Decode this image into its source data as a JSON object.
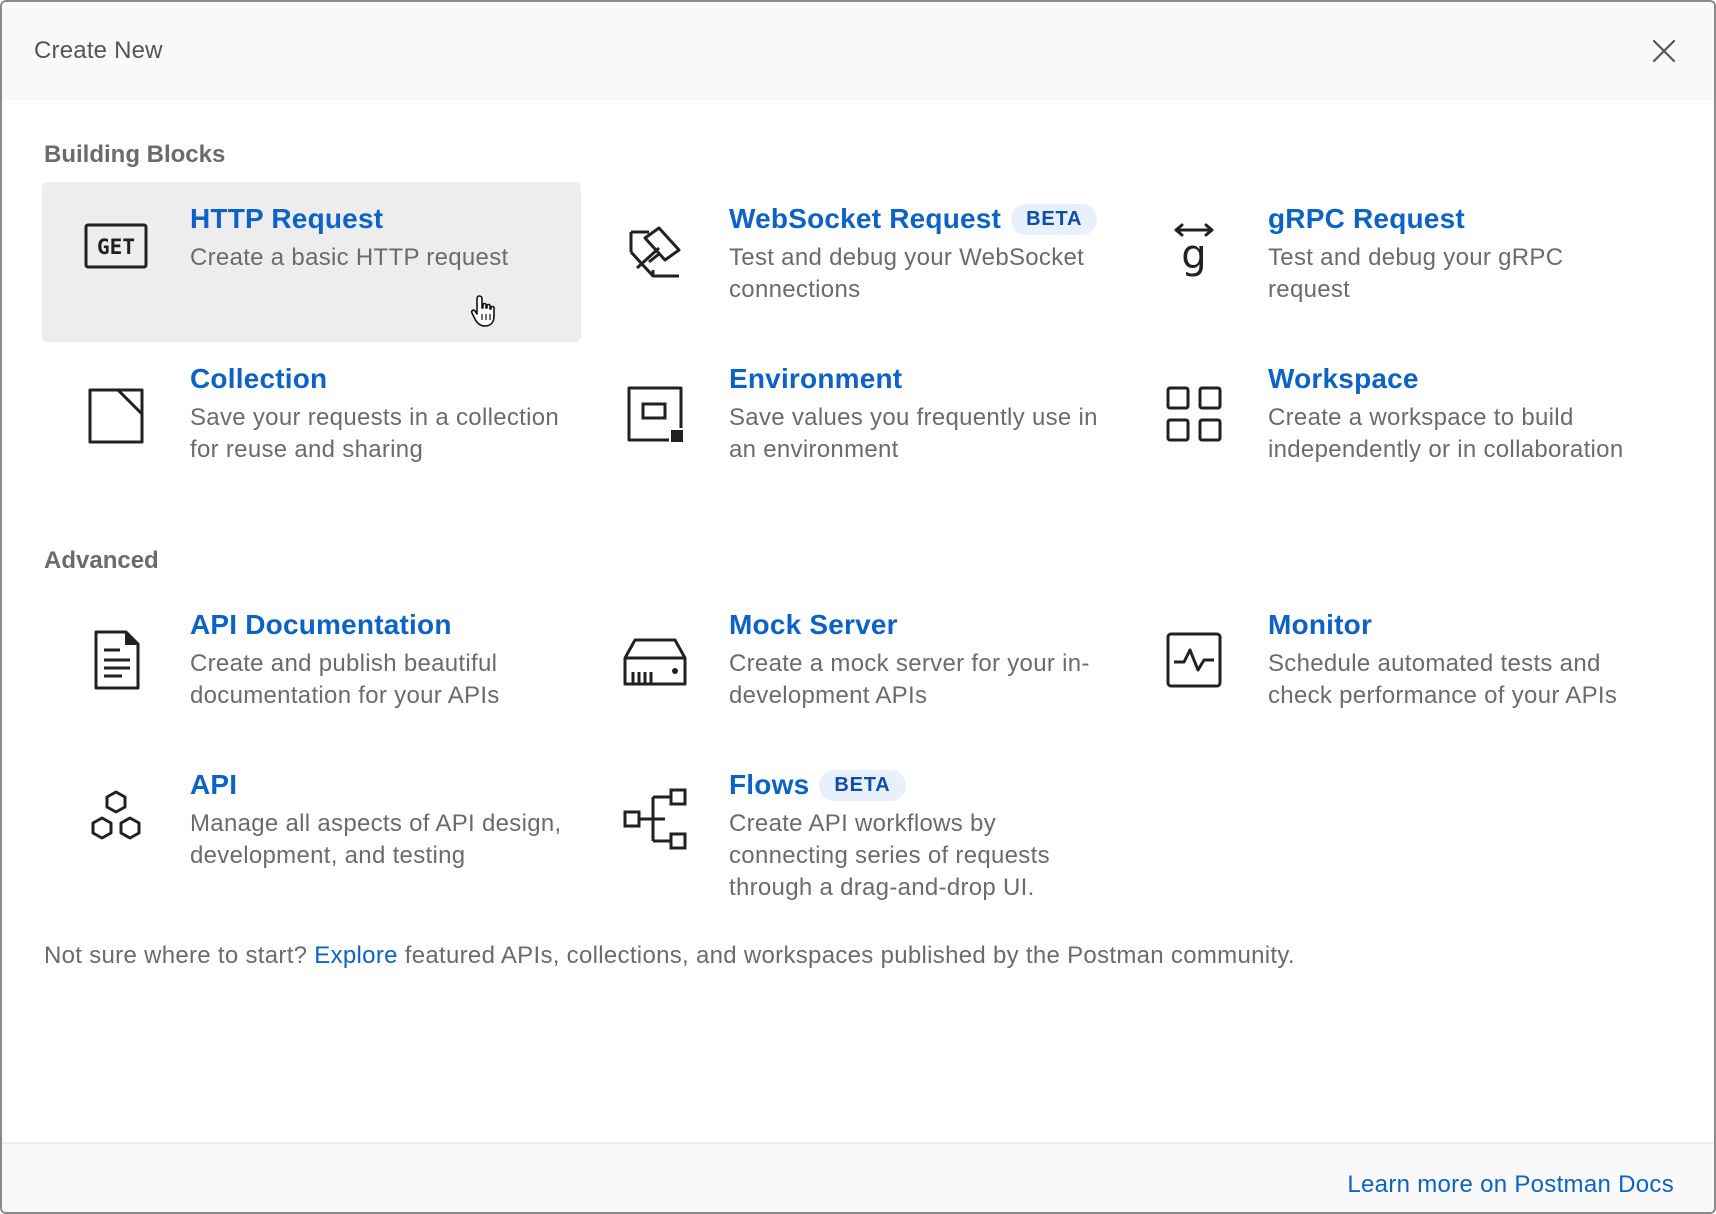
{
  "header": {
    "title": "Create New",
    "close_icon": "close-icon"
  },
  "building_blocks": {
    "title": "Building Blocks",
    "items": [
      {
        "title": "HTTP Request",
        "desc": "Create a basic HTTP request",
        "icon": "get-icon",
        "icon_text": "GET"
      },
      {
        "title": "WebSocket Request",
        "badge": "BETA",
        "desc": "Test and debug your WebSocket connections",
        "icon": "websocket-icon"
      },
      {
        "title": "gRPC Request",
        "desc": "Test and debug your gRPC request",
        "icon": "grpc-icon",
        "icon_text": "g"
      },
      {
        "title": "Collection",
        "desc": "Save your requests in a collection for reuse and sharing",
        "icon": "collection-icon"
      },
      {
        "title": "Environment",
        "desc": "Save values you frequently use in an environment",
        "icon": "environment-icon"
      },
      {
        "title": "Workspace",
        "desc": "Create a workspace to build independently or in collaboration",
        "icon": "workspace-icon"
      }
    ]
  },
  "advanced": {
    "title": "Advanced",
    "items": [
      {
        "title": "API Documentation",
        "desc": "Create and publish beautiful documentation for your APIs",
        "icon": "document-icon"
      },
      {
        "title": "Mock Server",
        "desc": "Create a mock server for your in-development APIs",
        "icon": "server-icon"
      },
      {
        "title": "Monitor",
        "desc": "Schedule automated tests and check performance of your APIs",
        "icon": "monitor-icon"
      },
      {
        "title": "API",
        "desc": "Manage all aspects of API design, development, and testing",
        "icon": "api-icon"
      },
      {
        "title": "Flows",
        "badge": "BETA",
        "desc": "Create API workflows by connecting series of requests through a drag-and-drop UI.",
        "icon": "flows-icon"
      }
    ]
  },
  "footer_note": {
    "prefix": "Not sure where to start?",
    "link": "Explore",
    "suffix": "featured APIs, collections, and workspaces published by the Postman community."
  },
  "bottom_bar": {
    "docs_link": "Learn more on Postman Docs"
  },
  "colors": {
    "link": "#0b63c9",
    "badge_bg": "#e8f0fb",
    "hover_bg": "#ededed"
  }
}
